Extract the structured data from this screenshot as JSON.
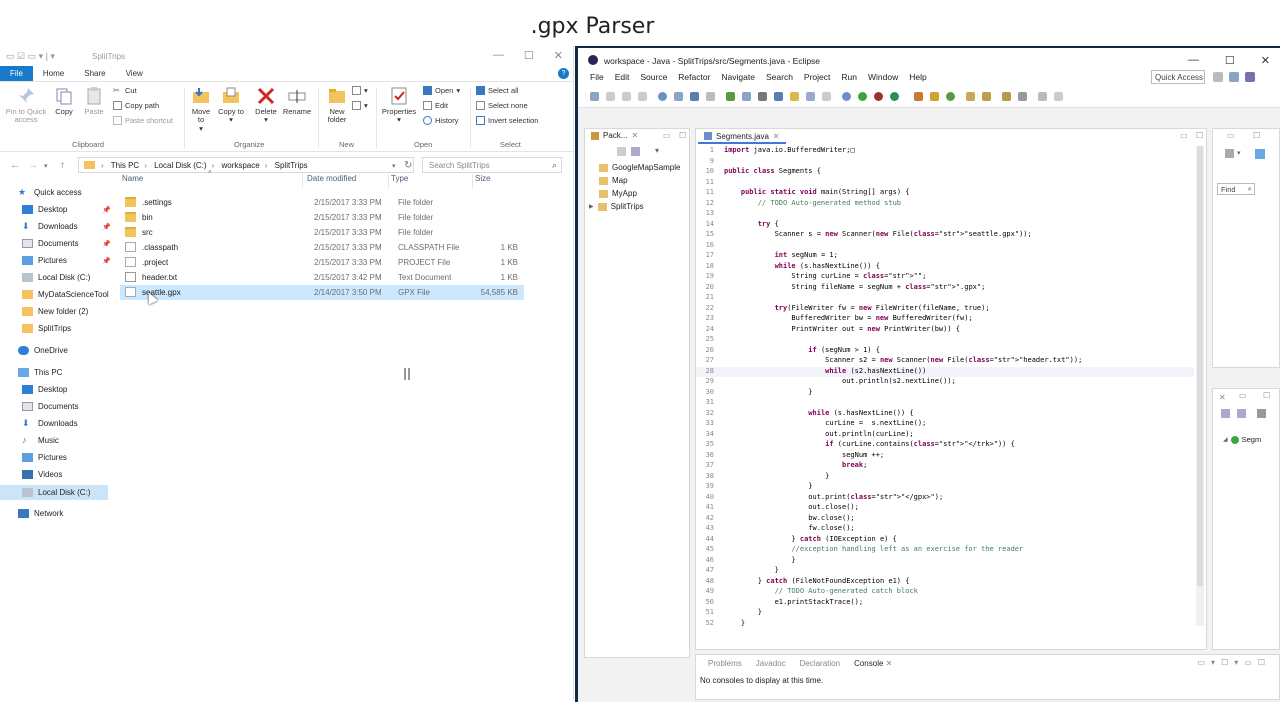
{
  "slide": {
    "title": ".gpx Parser"
  },
  "explorer": {
    "window_title": "SplitTrips",
    "tabs": [
      "File",
      "Home",
      "Share",
      "View"
    ],
    "ribbon": {
      "pin_label": "Pin to Quick access",
      "copy_label": "Copy",
      "paste_label": "Paste",
      "cut_label": "Cut",
      "copy_path_label": "Copy path",
      "paste_shortcut_label": "Paste shortcut",
      "move_to_label": "Move to",
      "copy_to_label": "Copy to",
      "delete_label": "Delete",
      "rename_label": "Rename",
      "new_folder_label": "New folder",
      "properties_label": "Properties",
      "open_label": "Open",
      "edit_label": "Edit",
      "history_label": "History",
      "select_all_label": "Select all",
      "select_none_label": "Select none",
      "invert_selection_label": "Invert selection",
      "groups": [
        "Clipboard",
        "Organize",
        "New",
        "Open",
        "Select"
      ]
    },
    "address": {
      "crumbs": [
        "This PC",
        "Local Disk (C:)",
        "workspace",
        "SplitTrips"
      ]
    },
    "search_placeholder": "Search SplitTrips",
    "nav": {
      "quick_access": "Quick access",
      "quick_items": [
        "Desktop",
        "Downloads",
        "Documents",
        "Pictures",
        "Local Disk (C:)",
        "MyDataScienceTool",
        "New folder (2)",
        "SplitTrips"
      ],
      "onedrive": "OneDrive",
      "this_pc": "This PC",
      "pc_items": [
        "Desktop",
        "Documents",
        "Downloads",
        "Music",
        "Pictures",
        "Videos",
        "Local Disk (C:)"
      ],
      "network": "Network"
    },
    "columns": {
      "name": "Name",
      "date": "Date modified",
      "type": "Type",
      "size": "Size"
    },
    "files": [
      {
        "name": ".settings",
        "date": "2/15/2017 3:33 PM",
        "type": "File folder",
        "size": ""
      },
      {
        "name": "bin",
        "date": "2/15/2017 3:33 PM",
        "type": "File folder",
        "size": ""
      },
      {
        "name": "src",
        "date": "2/15/2017 3:33 PM",
        "type": "File folder",
        "size": ""
      },
      {
        "name": ".classpath",
        "date": "2/15/2017 3:33 PM",
        "type": "CLASSPATH File",
        "size": "1 KB"
      },
      {
        "name": ".project",
        "date": "2/15/2017 3:33 PM",
        "type": "PROJECT File",
        "size": "1 KB"
      },
      {
        "name": "header.txt",
        "date": "2/15/2017 3:42 PM",
        "type": "Text Document",
        "size": "1 KB"
      },
      {
        "name": "seattle.gpx",
        "date": "2/14/2017 3:50 PM",
        "type": "GPX File",
        "size": "54,585 KB"
      }
    ]
  },
  "eclipse": {
    "window_title": "workspace - Java - SplitTrips/src/Segments.java - Eclipse",
    "menu": [
      "File",
      "Edit",
      "Source",
      "Refactor",
      "Navigate",
      "Search",
      "Project",
      "Run",
      "Window",
      "Help"
    ],
    "quick_access": "Quick Access",
    "package_explorer": {
      "tab": "Pack...",
      "items": [
        "GoogleMapSample",
        "Map",
        "MyApp",
        "SplitTrips"
      ]
    },
    "editor_tab": "Segments.java",
    "find_label": "Find",
    "outline_item": "Segm",
    "code_lines": [
      {
        "n": "1",
        "t": "import java.io.BufferedWriter;□"
      },
      {
        "n": "9",
        "t": ""
      },
      {
        "n": "10",
        "t": "public class Segments {"
      },
      {
        "n": "11",
        "t": ""
      },
      {
        "n": "11",
        "t": "    public static void main(String[] args) {"
      },
      {
        "n": "12",
        "t": "        // TODO Auto-generated method stub"
      },
      {
        "n": "13",
        "t": ""
      },
      {
        "n": "14",
        "t": "        try {"
      },
      {
        "n": "15",
        "t": "            Scanner s = new Scanner(new File(\"seattle.gpx\"));"
      },
      {
        "n": "16",
        "t": ""
      },
      {
        "n": "17",
        "t": "            int segNum = 1;"
      },
      {
        "n": "18",
        "t": "            while (s.hasNextLine()) {"
      },
      {
        "n": "19",
        "t": "                String curLine = \"\";"
      },
      {
        "n": "20",
        "t": "                String fileName = segNum + \".gpx\";"
      },
      {
        "n": "21",
        "t": ""
      },
      {
        "n": "22",
        "t": "            try(FileWriter fw = new FileWriter(fileName, true);"
      },
      {
        "n": "23",
        "t": "                BufferedWriter bw = new BufferedWriter(fw);"
      },
      {
        "n": "24",
        "t": "                PrintWriter out = new PrintWriter(bw)) {"
      },
      {
        "n": "25",
        "t": ""
      },
      {
        "n": "26",
        "t": "                    if (segNum > 1) {"
      },
      {
        "n": "27",
        "t": "                        Scanner s2 = new Scanner(new File(\"header.txt\"));"
      },
      {
        "n": "28",
        "t": "                        while (s2.hasNextLine())"
      },
      {
        "n": "29",
        "t": "                            out.println(s2.nextLine());"
      },
      {
        "n": "30",
        "t": "                    }"
      },
      {
        "n": "31",
        "t": ""
      },
      {
        "n": "32",
        "t": "                    while (s.hasNextLine()) {"
      },
      {
        "n": "33",
        "t": "                        curLine =  s.nextLine();"
      },
      {
        "n": "34",
        "t": "                        out.println(curLine);"
      },
      {
        "n": "35",
        "t": "                        if (curLine.contains(\"</trk>\")) {"
      },
      {
        "n": "36",
        "t": "                            segNum ++;"
      },
      {
        "n": "37",
        "t": "                            break;"
      },
      {
        "n": "38",
        "t": "                        }"
      },
      {
        "n": "39",
        "t": "                    }"
      },
      {
        "n": "40",
        "t": "                    out.print(\"</gpx>\");"
      },
      {
        "n": "41",
        "t": "                    out.close();"
      },
      {
        "n": "42",
        "t": "                    bw.close();"
      },
      {
        "n": "43",
        "t": "                    fw.close();"
      },
      {
        "n": "44",
        "t": "                } catch (IOException e) {"
      },
      {
        "n": "45",
        "t": "                //exception handling left as an exercise for the reader"
      },
      {
        "n": "46",
        "t": "                }"
      },
      {
        "n": "47",
        "t": "            }"
      },
      {
        "n": "48",
        "t": "        } catch (FileNotFoundException e1) {"
      },
      {
        "n": "49",
        "t": "            // TODO Auto-generated catch block"
      },
      {
        "n": "50",
        "t": "            e1.printStackTrace();"
      },
      {
        "n": "51",
        "t": "        }"
      },
      {
        "n": "52",
        "t": "    }"
      }
    ],
    "console": {
      "tabs": [
        "Problems",
        "Javadoc",
        "Declaration",
        "Console"
      ],
      "message": "No consoles to display at this time."
    }
  }
}
